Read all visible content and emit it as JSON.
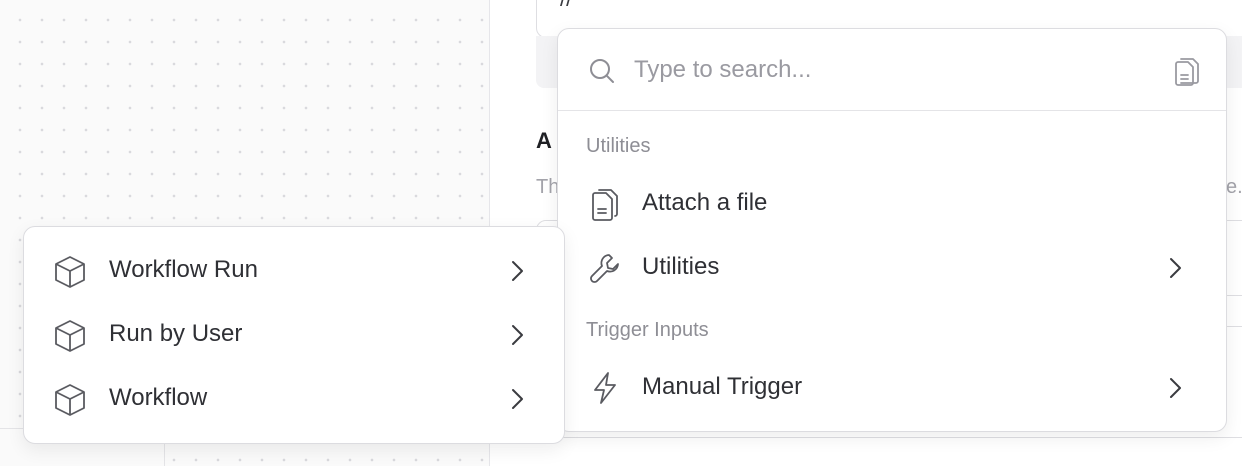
{
  "background_panel": {
    "input_text": "//",
    "heading": "A",
    "description_start": "Th",
    "description_end": "e."
  },
  "dropdown": {
    "search": {
      "placeholder": "Type to search...",
      "value": ""
    },
    "sections": [
      {
        "label": "Utilities",
        "items": [
          {
            "label": "Attach a file",
            "icon": "file-icon",
            "has_submenu": false
          },
          {
            "label": "Utilities",
            "icon": "wrench-icon",
            "has_submenu": true
          }
        ]
      },
      {
        "label": "Trigger Inputs",
        "items": [
          {
            "label": "Manual Trigger",
            "icon": "lightning-icon",
            "has_submenu": true
          }
        ]
      }
    ]
  },
  "submenu": {
    "items": [
      {
        "label": "Workflow Run",
        "icon": "cube-icon",
        "has_submenu": true
      },
      {
        "label": "Run by User",
        "icon": "cube-icon",
        "has_submenu": true
      },
      {
        "label": "Workflow",
        "icon": "cube-icon",
        "has_submenu": true
      }
    ]
  },
  "colors": {
    "text": "#2f3035",
    "muted": "#8e8e95",
    "placeholder": "#9a9aa1",
    "icon": "#5a5b61",
    "border": "#dcdce0"
  }
}
